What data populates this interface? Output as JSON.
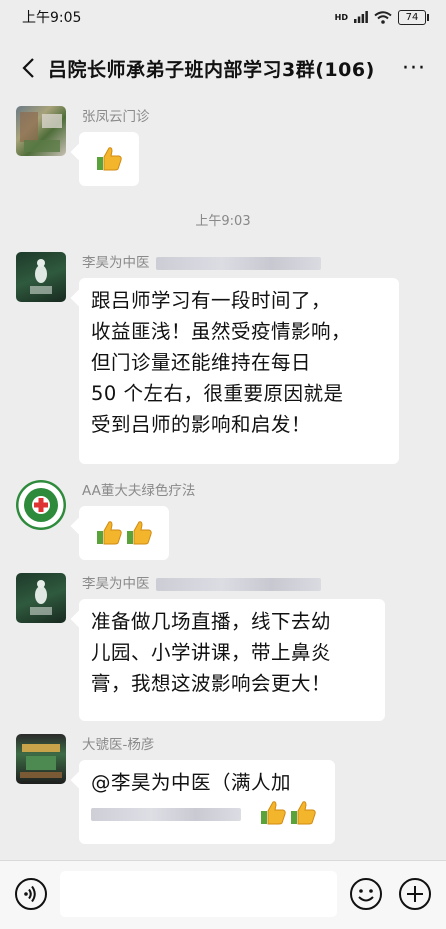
{
  "status_bar": {
    "time": "上午9:05",
    "signal_label": "HD",
    "battery": "74"
  },
  "header": {
    "title": "吕院长师承弟子班内部学习3群(106)",
    "more": "···"
  },
  "messages": [
    {
      "sender": "张凤云门诊",
      "content": "👍"
    },
    {
      "sender": "李昊为中医",
      "lines": [
        "跟吕师学习有一段时间了，",
        "收益匪浅！虽然受疫情影响，",
        "但门诊量还能维持在每日",
        "50 个左右，很重要原因就是",
        "受到吕师的影响和启发！"
      ]
    },
    {
      "sender": "AA董大夫绿色疗法",
      "content": "👍👍"
    },
    {
      "sender": "李昊为中医",
      "lines": [
        "准备做几场直播，线下去幼",
        "儿园、小学讲课，带上鼻炎",
        "膏，我想这波影响会更大！"
      ]
    },
    {
      "sender": "大號医-杨彦",
      "lines": [
        "@李昊为中医（满人加"
      ]
    }
  ],
  "time_divider": "上午9:03",
  "input_bar": {
    "voice_icon": "voice-icon",
    "emoji_icon": "emoji-icon",
    "plus_icon": "plus-icon"
  }
}
